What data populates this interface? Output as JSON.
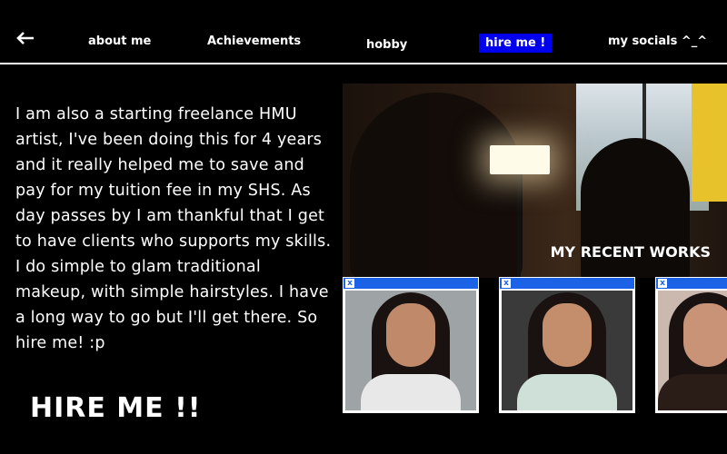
{
  "nav": {
    "items": [
      {
        "label": "about me"
      },
      {
        "label": "Achievements"
      },
      {
        "label": "hobby"
      },
      {
        "label": "hire me !"
      },
      {
        "label": "my socials ^_^"
      }
    ]
  },
  "intro": {
    "text": "I am also a starting freelance HMU artist, I've been doing this for 4 years and it really helped me to save and pay for my tuition fee in my SHS. As day passes by I am thankful that I get to have clients who supports my skills. I do simple to glam traditional makeup, with simple hairstyles. I have a long way to go but I'll get there. So hire me! :p"
  },
  "hire": {
    "heading": "HIRE ME !!"
  },
  "works": {
    "caption": "MY RECENT WORKS"
  },
  "thumbnails": [
    {
      "close": "x",
      "background": "#9ea3a6",
      "outfit": "#e8e8e8"
    },
    {
      "close": "x",
      "background": "#3a3a3a",
      "outfit": "#cfe0d8"
    },
    {
      "close": "x",
      "background": "#cbb8ae",
      "outfit": "#2a1c16"
    }
  ],
  "colors": {
    "background": "#000000",
    "text": "#ffffff",
    "accent": "#0000ee",
    "window_titlebar": "#1b62e6"
  }
}
